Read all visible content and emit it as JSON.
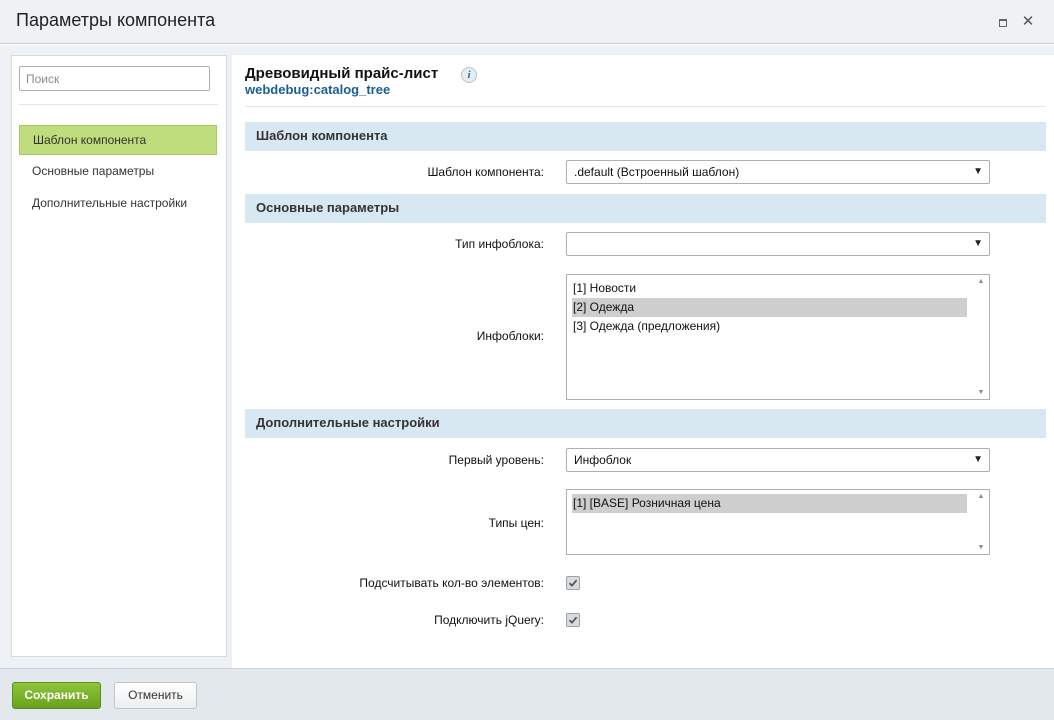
{
  "dialog": {
    "title": "Параметры компонента",
    "maximize_icon": "maximize-icon",
    "close_icon": "close-icon"
  },
  "sidebar": {
    "search_placeholder": "Поиск",
    "items": [
      {
        "label": "Шаблон компонента",
        "active": true
      },
      {
        "label": "Основные параметры",
        "active": false
      },
      {
        "label": "Дополнительные настройки",
        "active": false
      }
    ]
  },
  "component": {
    "name": "Древовидный прайс-лист",
    "code": "webdebug:catalog_tree",
    "info_icon": "info-icon"
  },
  "sections": [
    {
      "title": "Шаблон компонента"
    },
    {
      "title": "Основные параметры"
    },
    {
      "title": "Дополнительные настройки"
    }
  ],
  "fields": {
    "template": {
      "label": "Шаблон компонента:",
      "value": ".default (Встроенный шаблон)"
    },
    "iblock_type": {
      "label": "Тип инфоблока:",
      "value": ""
    },
    "iblocks": {
      "label": "Инфоблоки:",
      "options": [
        "[1] Новости",
        "[2] Одежда",
        "[3] Одежда (предложения)"
      ],
      "selected_index": 1
    },
    "first_level": {
      "label": "Первый уровень:",
      "value": "Инфоблок"
    },
    "price_types": {
      "label": "Типы цен:",
      "options": [
        "[1] [BASE] Розничная цена"
      ],
      "selected_index": 0
    },
    "count_elements": {
      "label": "Подсчитывать кол-во элементов:",
      "checked": true
    },
    "include_jquery": {
      "label": "Подключить jQuery:",
      "checked": true
    }
  },
  "footer": {
    "save_label": "Сохранить",
    "cancel_label": "Отменить"
  },
  "colors": {
    "save_button": "#76b22a",
    "active_sidebar_item": "#bfdd7c",
    "section_header": "#d8e8f2",
    "component_code": "#1a5f93"
  }
}
